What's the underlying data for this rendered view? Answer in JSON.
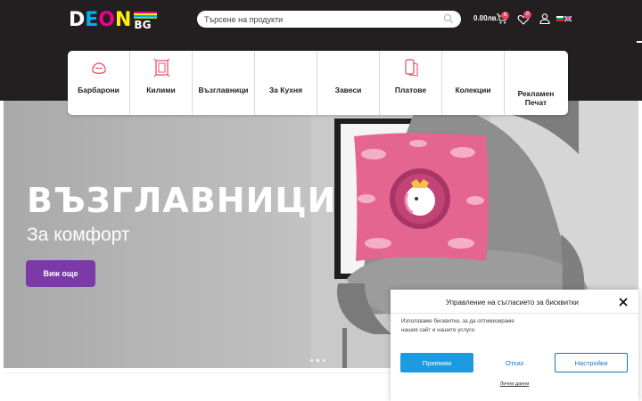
{
  "brand": {
    "logo_letters": [
      "D",
      "E",
      "O",
      "N"
    ],
    "logo_colors": [
      "#ffffff",
      "#00aeef",
      "#ec008c",
      "#fff200"
    ],
    "logo_suffix": "BG",
    "stripe_colors": [
      "#ec008c",
      "#fff200",
      "#00aeef",
      "#8dc63f"
    ]
  },
  "header": {
    "search_placeholder": "Търсене на продукти",
    "cart_total": "0.00лв.",
    "cart_count": "0",
    "wishlist_count": "0"
  },
  "categories": [
    {
      "label": "Барбарони",
      "icon": "beanbag-icon"
    },
    {
      "label": "Килими",
      "icon": "rug-icon"
    },
    {
      "label": "Възглавници",
      "icon": "pillow-icon"
    },
    {
      "label": "За Кухня",
      "icon": ""
    },
    {
      "label": "Завеси",
      "icon": ""
    },
    {
      "label": "Платове",
      "icon": "fabric-roll-icon"
    },
    {
      "label": "Колекции",
      "icon": ""
    },
    {
      "label": "Рекламен Печат",
      "icon": ""
    }
  ],
  "hero": {
    "title": "ВЪЗГЛАВНИЦИ",
    "subtitle": "За комфорт",
    "button": "Виж още",
    "slide_count": 3,
    "active_slide": 2
  },
  "cookie": {
    "title": "Управление на съгласието за бисквитки",
    "text": "Използваме бисквитки, за да оптимизираме нашия сайт и нашите услуги.",
    "accept": "Приемам",
    "deny": "Отказ",
    "settings": "Настройки",
    "link": "Лични данни"
  },
  "colors": {
    "header_bg": "#231f20",
    "accent_purple": "#7b3aa7",
    "accent_pink": "#e8455d",
    "cookie_blue": "#1e9be0"
  }
}
